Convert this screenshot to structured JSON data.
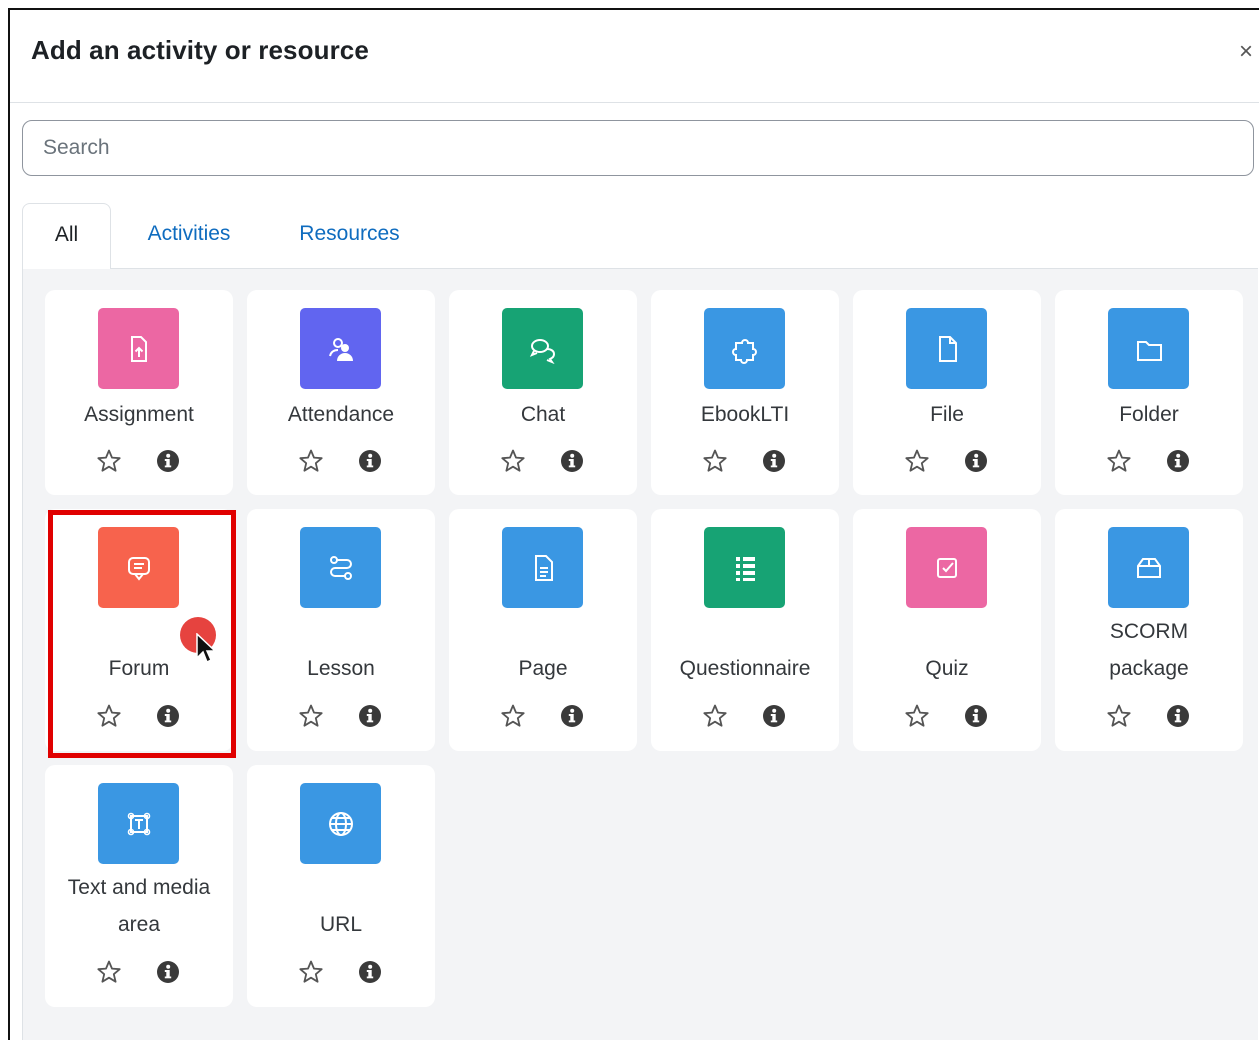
{
  "modal": {
    "title": "Add an activity or resource",
    "close_symbol": "×"
  },
  "search": {
    "placeholder": "Search",
    "value": ""
  },
  "tabs": [
    {
      "label": "All",
      "active": true
    },
    {
      "label": "Activities",
      "active": false
    },
    {
      "label": "Resources",
      "active": false
    }
  ],
  "activities": [
    {
      "name_line1": "Assignment",
      "name_line2": "",
      "icon": "assignment-icon",
      "color": "#ec67a3"
    },
    {
      "name_line1": "Attendance",
      "name_line2": "",
      "icon": "attendance-icon",
      "color": "#6165f0"
    },
    {
      "name_line1": "Chat",
      "name_line2": "",
      "icon": "chat-icon",
      "color": "#17a374"
    },
    {
      "name_line1": "EbookLTI",
      "name_line2": "",
      "icon": "puzzle-icon",
      "color": "#3a97e3"
    },
    {
      "name_line1": "File",
      "name_line2": "",
      "icon": "file-icon",
      "color": "#3a97e3"
    },
    {
      "name_line1": "Folder",
      "name_line2": "",
      "icon": "folder-icon",
      "color": "#3a97e3"
    },
    {
      "name_line1": "Forum",
      "name_line2": "",
      "icon": "forum-icon",
      "color": "#f7634d"
    },
    {
      "name_line1": "Lesson",
      "name_line2": "",
      "icon": "lesson-icon",
      "color": "#3a97e3"
    },
    {
      "name_line1": "Page",
      "name_line2": "",
      "icon": "page-icon",
      "color": "#3a97e3"
    },
    {
      "name_line1": "Questionnaire",
      "name_line2": "",
      "icon": "questionnaire-icon",
      "color": "#17a374"
    },
    {
      "name_line1": "Quiz",
      "name_line2": "",
      "icon": "quiz-icon",
      "color": "#ec67a3"
    },
    {
      "name_line1": "SCORM",
      "name_line2": "package",
      "icon": "scorm-icon",
      "color": "#3a97e3"
    },
    {
      "name_line1": "Text and media",
      "name_line2": "area",
      "icon": "text-media-icon",
      "color": "#3a97e3"
    },
    {
      "name_line1": "URL",
      "name_line2": "",
      "icon": "globe-icon",
      "color": "#3a97e3"
    }
  ]
}
